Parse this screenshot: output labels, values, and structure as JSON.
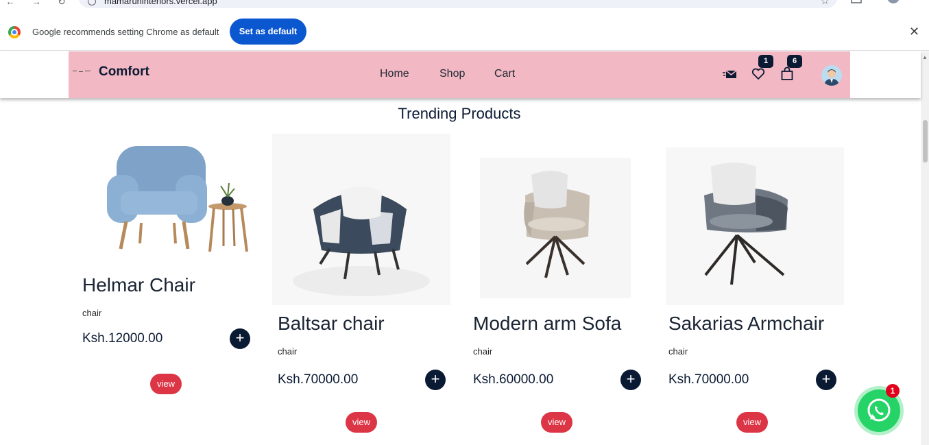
{
  "browser": {
    "url": "mamaruninteriors.vercel.app",
    "infobar_text": "Google recommends setting Chrome as default",
    "set_default_label": "Set as default"
  },
  "header": {
    "brand": "Comfort",
    "nav": [
      "Home",
      "Shop",
      "Cart"
    ],
    "wishlist_count": "1",
    "cart_count": "6"
  },
  "section": {
    "title": "Trending Products"
  },
  "products": [
    {
      "name": "Helmar Chair",
      "category": "chair",
      "price": "Ksh.12000.00",
      "view_label": "view",
      "add_label": "+"
    },
    {
      "name": "Baltsar chair",
      "category": "chair",
      "price": "Ksh.70000.00",
      "view_label": "view",
      "add_label": "+"
    },
    {
      "name": "Modern arm Sofa",
      "category": "chair",
      "price": "Ksh.60000.00",
      "view_label": "view",
      "add_label": "+"
    },
    {
      "name": "Sakarias Armchair",
      "category": "chair",
      "price": "Ksh.70000.00",
      "view_label": "view",
      "add_label": "+"
    }
  ],
  "whatsapp": {
    "badge": "1"
  },
  "colors": {
    "header_bg": "#f2b8c3",
    "navy": "#0b1a33",
    "view_red": "#dc3545",
    "whatsapp_green": "#25d366"
  }
}
